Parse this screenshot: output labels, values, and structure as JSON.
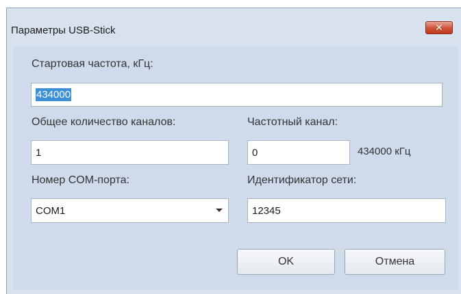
{
  "window": {
    "title": "Параметры USB-Stick"
  },
  "form": {
    "start_freq_label": "Стартовая частота, кГц:",
    "start_freq_value": "434000",
    "channels_label": "Общее количество каналов:",
    "channels_value": "1",
    "freq_channel_label": "Частотный канал:",
    "freq_channel_value": "0",
    "freq_channel_info": "434000 кГц",
    "com_port_label": "Номер COM-порта:",
    "com_port_value": "COM1",
    "network_id_label": "Идентификатор сети:",
    "network_id_value": "12345"
  },
  "buttons": {
    "ok": "OK",
    "cancel": "Отмена"
  },
  "colors": {
    "frame": "#d8e2ee",
    "client": "#cfdbea",
    "selection": "#3d8fd8",
    "close": "#cf5238"
  },
  "icons": {
    "close": "close-icon",
    "dropdown": "chevron-down-icon"
  }
}
